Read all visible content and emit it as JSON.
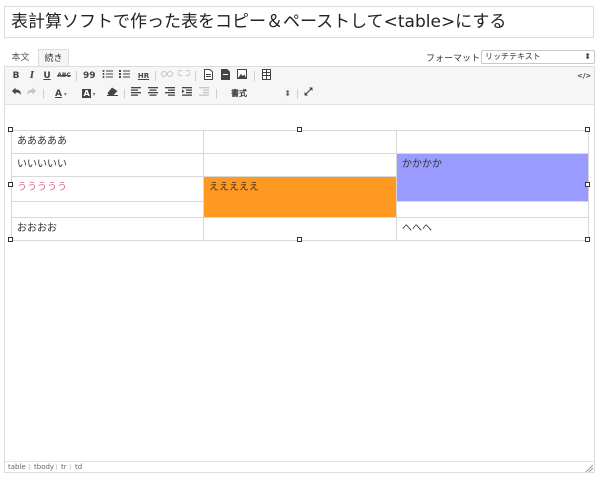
{
  "title": "表計算ソフトで作った表をコピー＆ペーストして<table>にする",
  "tabs": {
    "text": "本文",
    "visual": "続き"
  },
  "format": {
    "label": "フォーマット:",
    "value": "リッチテキスト"
  },
  "toolbar": {
    "bold": "B",
    "italic": "I",
    "underline": "U",
    "strike": "ABC",
    "blockquote": "99",
    "hr": "HR",
    "html_toggle": "</>",
    "style_select": "書式"
  },
  "table": {
    "rows": [
      [
        "あああああ",
        "",
        ""
      ],
      [
        "いいいいい",
        "",
        "かかかか"
      ],
      [
        "ううううう",
        "えええええ",
        ""
      ],
      [
        "",
        "",
        ""
      ],
      [
        "おおおお",
        "",
        "へへへ"
      ]
    ],
    "colors": {
      "pink_text": "#e85e9a",
      "orange_bg": "#ff9921",
      "purple_bg": "#999bff"
    }
  },
  "status_path": [
    "table",
    "tbody",
    "tr",
    "td"
  ]
}
